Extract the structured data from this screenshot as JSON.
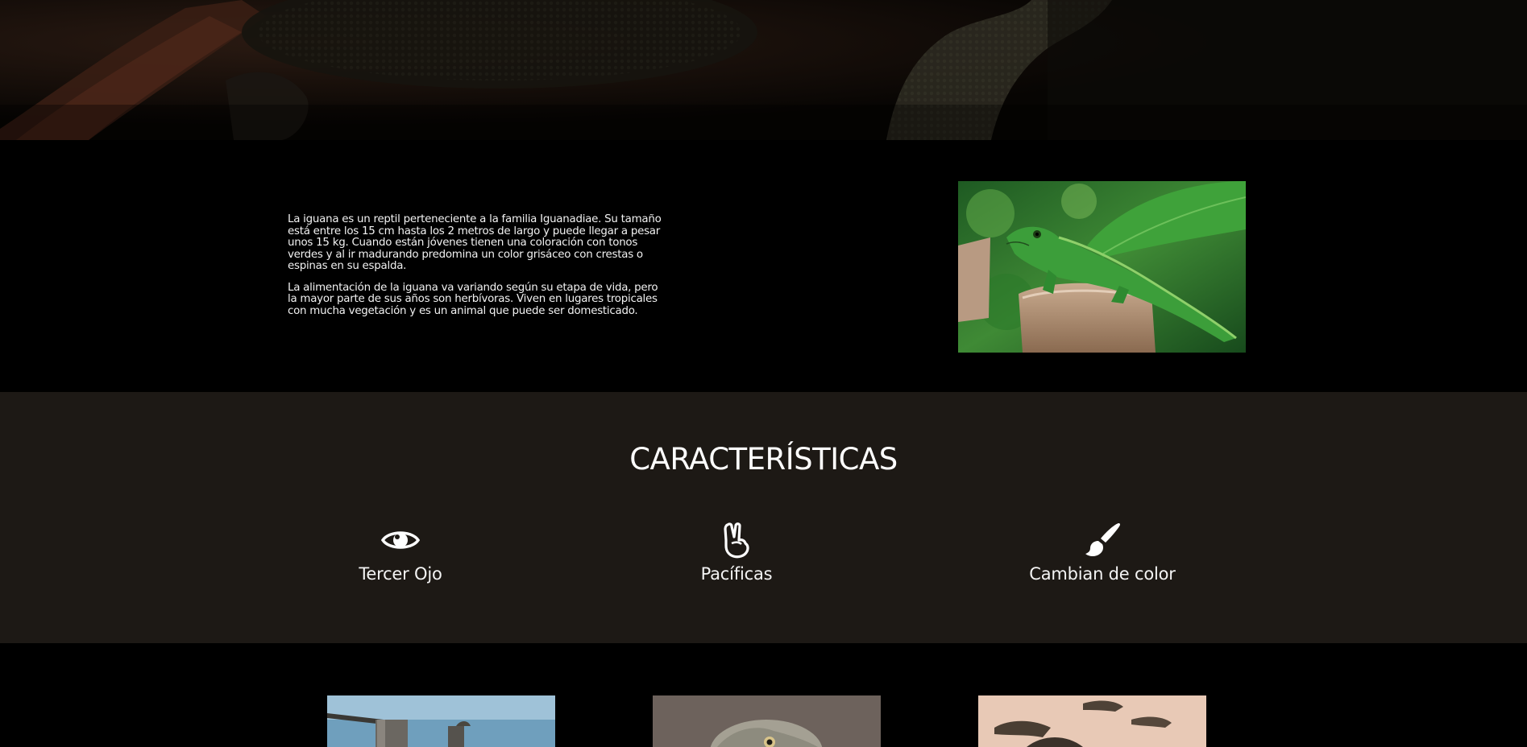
{
  "hero": {
    "image": "iguana-closeup-dark-photo"
  },
  "intro": {
    "paragraphs": [
      "La iguana es un reptil perteneciente a la familia Iguanadiae. Su tamaño está entre los 15 cm hasta los 2 metros de largo y puede llegar a pesar unos 15 kg. Cuando están jóvenes tienen una coloración con tonos verdes y al ir madurando predomina un color grisáceo con crestas o espinas en su espalda.",
      "La alimentación de la iguana va variando según su etapa de vida, pero la mayor parte de sus años son herbívoras. Viven en lugares tropicales con mucha vegetación y es un animal que puede ser domesticado."
    ],
    "image": "green-iguana-on-stump-photo"
  },
  "features": {
    "title": "CARACTERÍSTICAS",
    "items": [
      {
        "icon": "eye-icon",
        "label": "Tercer Ojo"
      },
      {
        "icon": "peace-hand-icon",
        "label": "Pacíficas"
      },
      {
        "icon": "paintbrush-icon",
        "label": "Cambian de color"
      }
    ]
  },
  "gallery": {
    "images": [
      "iguana-on-dock-photo",
      "iguana-face-photo",
      "iguanas-on-sand-photo"
    ]
  },
  "colors": {
    "page_background": "#000000",
    "features_background": "#1d1915",
    "text": "#ffffff"
  }
}
